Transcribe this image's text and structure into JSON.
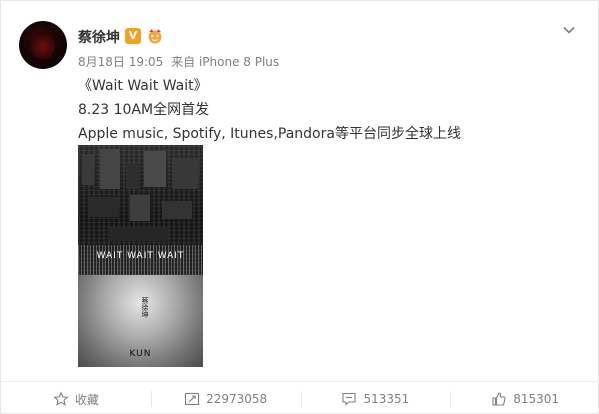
{
  "user": {
    "name": "蔡徐坤",
    "verified_mark": "V"
  },
  "post": {
    "date": "8月18日 19:05",
    "source": "来自 iPhone 8 Plus",
    "lines": [
      "《Wait Wait Wait》",
      "8.23 10AM全网首发",
      "Apple music, Spotify, Itunes,Pandora等平台同步全球上线"
    ],
    "image": {
      "title_text": "WAIT WAIT WAIT",
      "vertical_text": "蔡徐坤",
      "artist_text": "KUN"
    }
  },
  "actions": {
    "favorite_label": "收藏",
    "repost_count": "22973058",
    "comment_count": "513351",
    "like_count": "815301"
  },
  "icons": {
    "menu": "chevron-down-icon",
    "favorite": "star-icon",
    "repost": "repost-icon",
    "comment": "comment-icon",
    "like": "thumbs-up-icon"
  },
  "colors": {
    "verified": "#f2a122",
    "text_primary": "#333333",
    "text_secondary": "#808080"
  }
}
